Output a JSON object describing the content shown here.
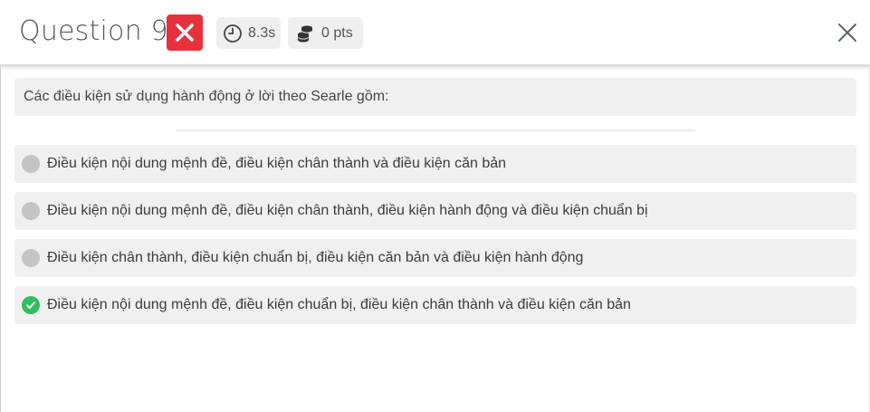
{
  "header": {
    "title": "Question 9",
    "result": "wrong",
    "time_label": "8.3s",
    "points_label": "0 pts",
    "icons": {
      "result": "x-mark-icon",
      "time": "clock-icon",
      "points": "coins-icon",
      "close": "close-icon"
    }
  },
  "question": {
    "text": "Các điều kiện sử dụng hành động ở lời theo Searle gồm:"
  },
  "options": [
    {
      "text": "Điều kiện nội dung mệnh đề, điều kiện chân thành và điều kiện căn bản",
      "state": "neutral"
    },
    {
      "text": "Điều kiện nội dung mệnh đề, điều kiện chân thành, điều kiện hành động và điều kiện chuẩn bị",
      "state": "neutral"
    },
    {
      "text": "Điều kiện chân thành, điều kiện chuẩn bị, điều kiện căn bản và điều kiện hành động",
      "state": "neutral"
    },
    {
      "text": "Điều kiện nội dung mệnh đề, điều kiện chuẩn bị, điều kiện chân thành và điều kiện căn bản",
      "state": "correct"
    }
  ],
  "colors": {
    "wrong_badge": "#e5323d",
    "correct": "#2fbf5d",
    "neutral_dot": "#c4c4c4",
    "panel_bg": "#f0f0f0"
  }
}
